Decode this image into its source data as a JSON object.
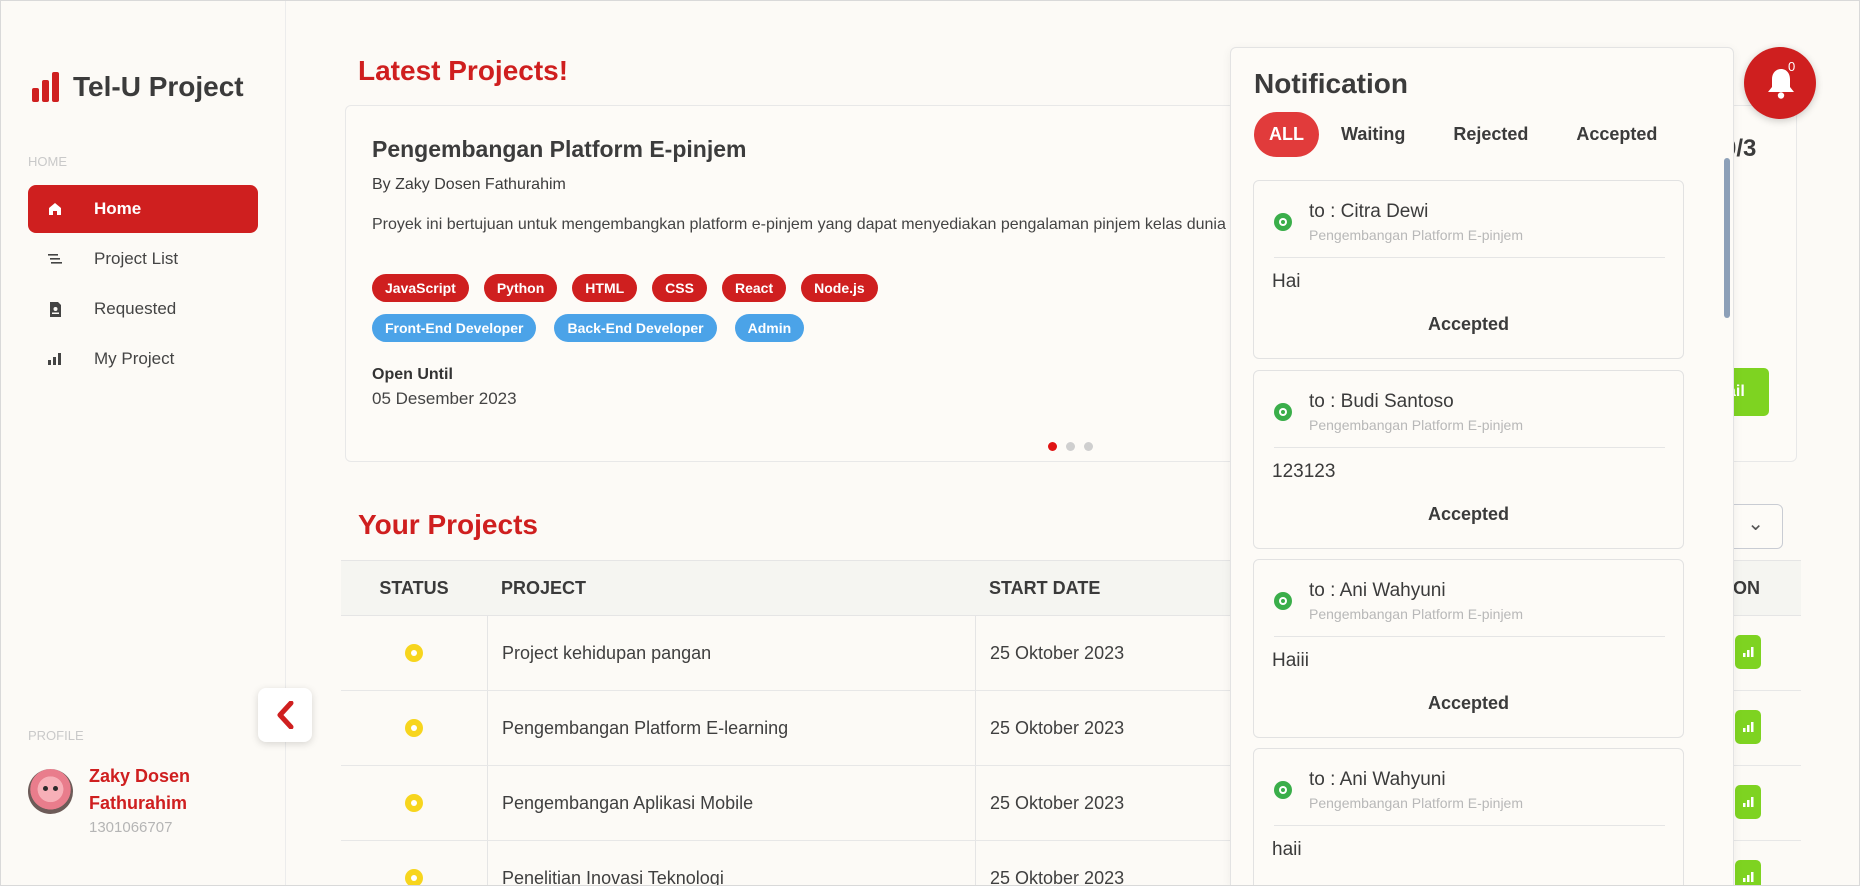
{
  "app": {
    "name": "Tel-U Project"
  },
  "sidebar": {
    "home_label": "HOME",
    "items": [
      {
        "label": "Home",
        "icon": "home-icon"
      },
      {
        "label": "Project List",
        "icon": "list-icon"
      },
      {
        "label": "Requested",
        "icon": "document-icon"
      },
      {
        "label": "My Project",
        "icon": "bar-chart-icon"
      }
    ],
    "profile_label": "PROFILE",
    "profile": {
      "name": "Zaky Dosen Fathurahim",
      "id": "1301066707"
    }
  },
  "latest": {
    "title": "Latest Projects!",
    "card": {
      "title": "Pengembangan Platform E-pinjem",
      "by": "By Zaky Dosen Fathurahim",
      "description": "Proyek ini bertujuan untuk mengembangkan platform e-pinjem yang dapat menyediakan pengalaman pinjem kelas dunia",
      "tech_tags": [
        "JavaScript",
        "Python",
        "HTML",
        "CSS",
        "React",
        "Node.js"
      ],
      "role_tags": [
        "Front-End Developer",
        "Back-End Developer",
        "Admin"
      ],
      "open_label": "Open Until",
      "open_date": "05 Desember 2023",
      "count": "0/3",
      "detail_label": "ail"
    }
  },
  "your_projects": {
    "title": "Your Projects",
    "columns": {
      "status": "STATUS",
      "project": "PROJECT",
      "start_date": "START DATE",
      "action": "ON"
    },
    "rows": [
      {
        "project": "Project kehidupan pangan",
        "start_date": "25 Oktober 2023"
      },
      {
        "project": "Pengembangan Platform E-learning",
        "start_date": "25 Oktober 2023"
      },
      {
        "project": "Pengembangan Aplikasi Mobile",
        "start_date": "25 Oktober 2023"
      },
      {
        "project": "Penelitian Inovasi Teknologi",
        "start_date": "25 Oktober 2023"
      }
    ]
  },
  "notification": {
    "title": "Notification",
    "tabs": [
      "ALL",
      "Waiting",
      "Rejected",
      "Accepted"
    ],
    "items": [
      {
        "to": "to : Citra Dewi",
        "project": "Pengembangan Platform E-pinjem",
        "message": "Hai",
        "status": "Accepted"
      },
      {
        "to": "to : Budi Santoso",
        "project": "Pengembangan Platform E-pinjem",
        "message": "123123",
        "status": "Accepted"
      },
      {
        "to": "to : Ani Wahyuni",
        "project": "Pengembangan Platform E-pinjem",
        "message": "Haiii",
        "status": "Accepted"
      },
      {
        "to": "to : Ani Wahyuni",
        "project": "Pengembangan Platform E-pinjem",
        "message": "haii",
        "status": ""
      }
    ],
    "bell_count": "0"
  },
  "colors": {
    "brand_red": "#cf1f1f",
    "tag_blue": "#4ba3e8",
    "success_green": "#7ed321",
    "pending_yellow": "#f7d51d"
  }
}
